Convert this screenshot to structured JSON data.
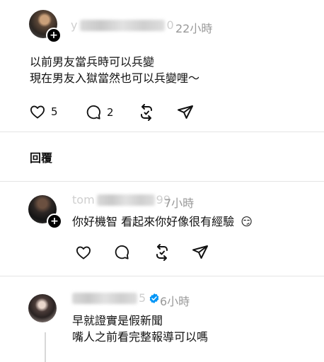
{
  "post": {
    "username_hint": "y",
    "username_tail": "0",
    "timestamp": "22小時",
    "lines": [
      "以前男友當兵時可以兵變",
      "現在男友入獄當然也可以兵變哩～"
    ],
    "likes": "5",
    "replies": "2"
  },
  "replies_section": {
    "title": "回覆"
  },
  "reply1": {
    "username_hint": "tom",
    "username_tail": "99",
    "timestamp": "7小時",
    "text": "你好機智 看起來你好像很有經驗",
    "emoji": "😏"
  },
  "reply2": {
    "username_tail": "5",
    "timestamp": "6小時",
    "lines": [
      "早就證實是假新聞",
      "嘴人之前看完整報導可以嗎"
    ]
  },
  "colors": {
    "verified": "#0095f6",
    "muted": "#999999"
  },
  "icons": [
    "heart-icon",
    "comment-icon",
    "repost-icon",
    "share-icon",
    "plus-icon",
    "verified-badge-icon"
  ]
}
